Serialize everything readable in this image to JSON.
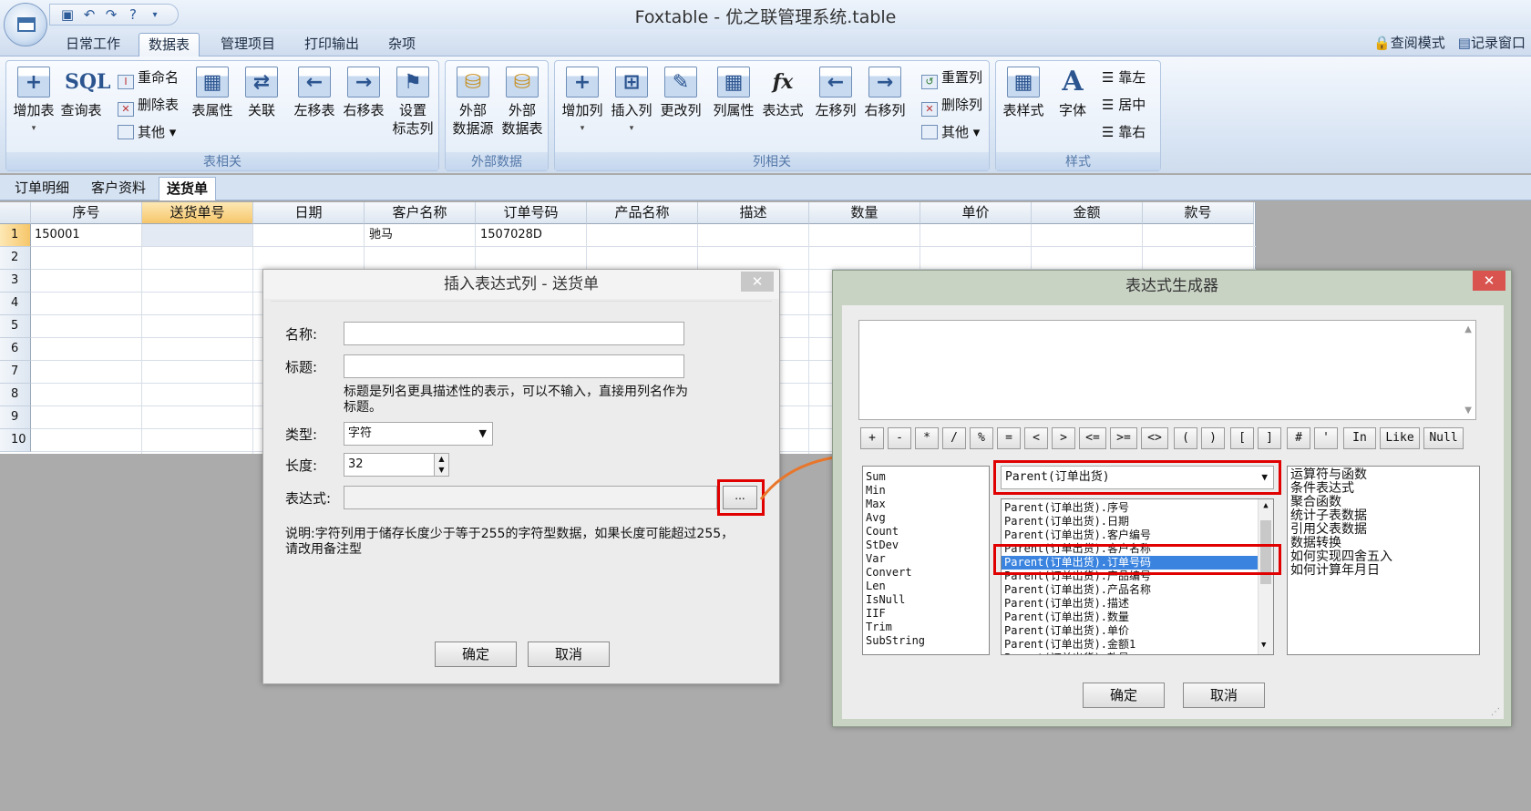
{
  "app": {
    "title": "Foxtable - 优之联管理系统.table"
  },
  "ribbon": {
    "tabs": [
      "日常工作",
      "数据表",
      "管理项目",
      "打印输出",
      "杂项"
    ],
    "active_tab": "数据表",
    "right_links": [
      "查阅模式",
      "记录窗口"
    ],
    "groups": {
      "table": {
        "label": "表相关",
        "buttons": [
          "增加表",
          "查询表",
          "表属性",
          "关联",
          "左移表",
          "右移表",
          "设置\n标志列"
        ],
        "small": [
          "重命名",
          "删除表",
          "其他"
        ]
      },
      "external": {
        "label": "外部数据",
        "buttons": [
          "外部\n数据源",
          "外部\n数据表"
        ]
      },
      "column": {
        "label": "列相关",
        "buttons": [
          "增加列",
          "插入列",
          "更改列",
          "列属性",
          "表达式",
          "左移列",
          "右移列"
        ],
        "small": [
          "重置列",
          "删除列",
          "其他"
        ]
      },
      "style": {
        "label": "样式",
        "buttons": [
          "表样式",
          "字体"
        ],
        "small": [
          "靠左",
          "居中",
          "靠右"
        ]
      }
    },
    "sql_text": "SQL",
    "fx_text": "fx"
  },
  "sheet_tabs": [
    "订单明细",
    "客户资料",
    "送货单"
  ],
  "active_sheet": "送货单",
  "grid": {
    "columns": [
      "序号",
      "送货单号",
      "日期",
      "客户名称",
      "订单号码",
      "产品名称",
      "描述",
      "数量",
      "单价",
      "金额",
      "款号"
    ],
    "selected_column": "送货单号",
    "row_numbers": [
      "1",
      "2",
      "3",
      "4",
      "5",
      "6",
      "7",
      "8",
      "9",
      "10"
    ],
    "row1": {
      "seq": "150001",
      "customer": "驰马",
      "order": "1507028D"
    }
  },
  "insert_dialog": {
    "title": "插入表达式列 - 送货单",
    "name_label": "名称:",
    "caption_label": "标题:",
    "caption_hint": "标题是列名更具描述性的表示，可以不输入，直接用列名作为标题。",
    "type_label": "类型:",
    "type_value": "字符",
    "length_label": "长度:",
    "length_value": "32",
    "expr_label": "表达式:",
    "expr_button": "...",
    "note": "说明:字符列用于储存长度少于等于255的字符型数据，如果长度可能超过255，请改用备注型",
    "ok": "确定",
    "cancel": "取消"
  },
  "expr_dialog": {
    "title": "表达式生成器",
    "operators": [
      "+",
      "-",
      "*",
      "/",
      "%",
      "=",
      "<",
      ">",
      "<=",
      ">=",
      "<>",
      "(",
      ")",
      "[",
      "]",
      "#",
      "'",
      "In",
      "Like",
      "Null"
    ],
    "functions": [
      "Sum",
      "Min",
      "Max",
      "Avg",
      "Count",
      "StDev",
      "Var",
      "Convert",
      "Len",
      "IsNull",
      "IIF",
      "Trim",
      "SubString"
    ],
    "combo_value": "Parent(订单出货)",
    "fields": [
      "Parent(订单出货).序号",
      "Parent(订单出货).日期",
      "Parent(订单出货).客户编号",
      "Parent(订单出货).客户名称",
      "Parent(订单出货).订单号码",
      "Parent(订单出货).产品编号",
      "Parent(订单出货).产品名称",
      "Parent(订单出货).描述",
      "Parent(订单出货).数量",
      "Parent(订单出货).单价",
      "Parent(订单出货).金额1",
      "Parent(订单出货).款号"
    ],
    "selected_field": "Parent(订单出货).订单号码",
    "categories": [
      "运算符与函数",
      "条件表达式",
      "聚合函数",
      "统计子表数据",
      "引用父表数据",
      "数据转换",
      "如何实现四舍五入",
      "如何计算年月日"
    ],
    "ok": "确定",
    "cancel": "取消"
  },
  "colors": {
    "accent": "#3a84e0",
    "highlight": "#e00000",
    "close": "#d9534f"
  }
}
